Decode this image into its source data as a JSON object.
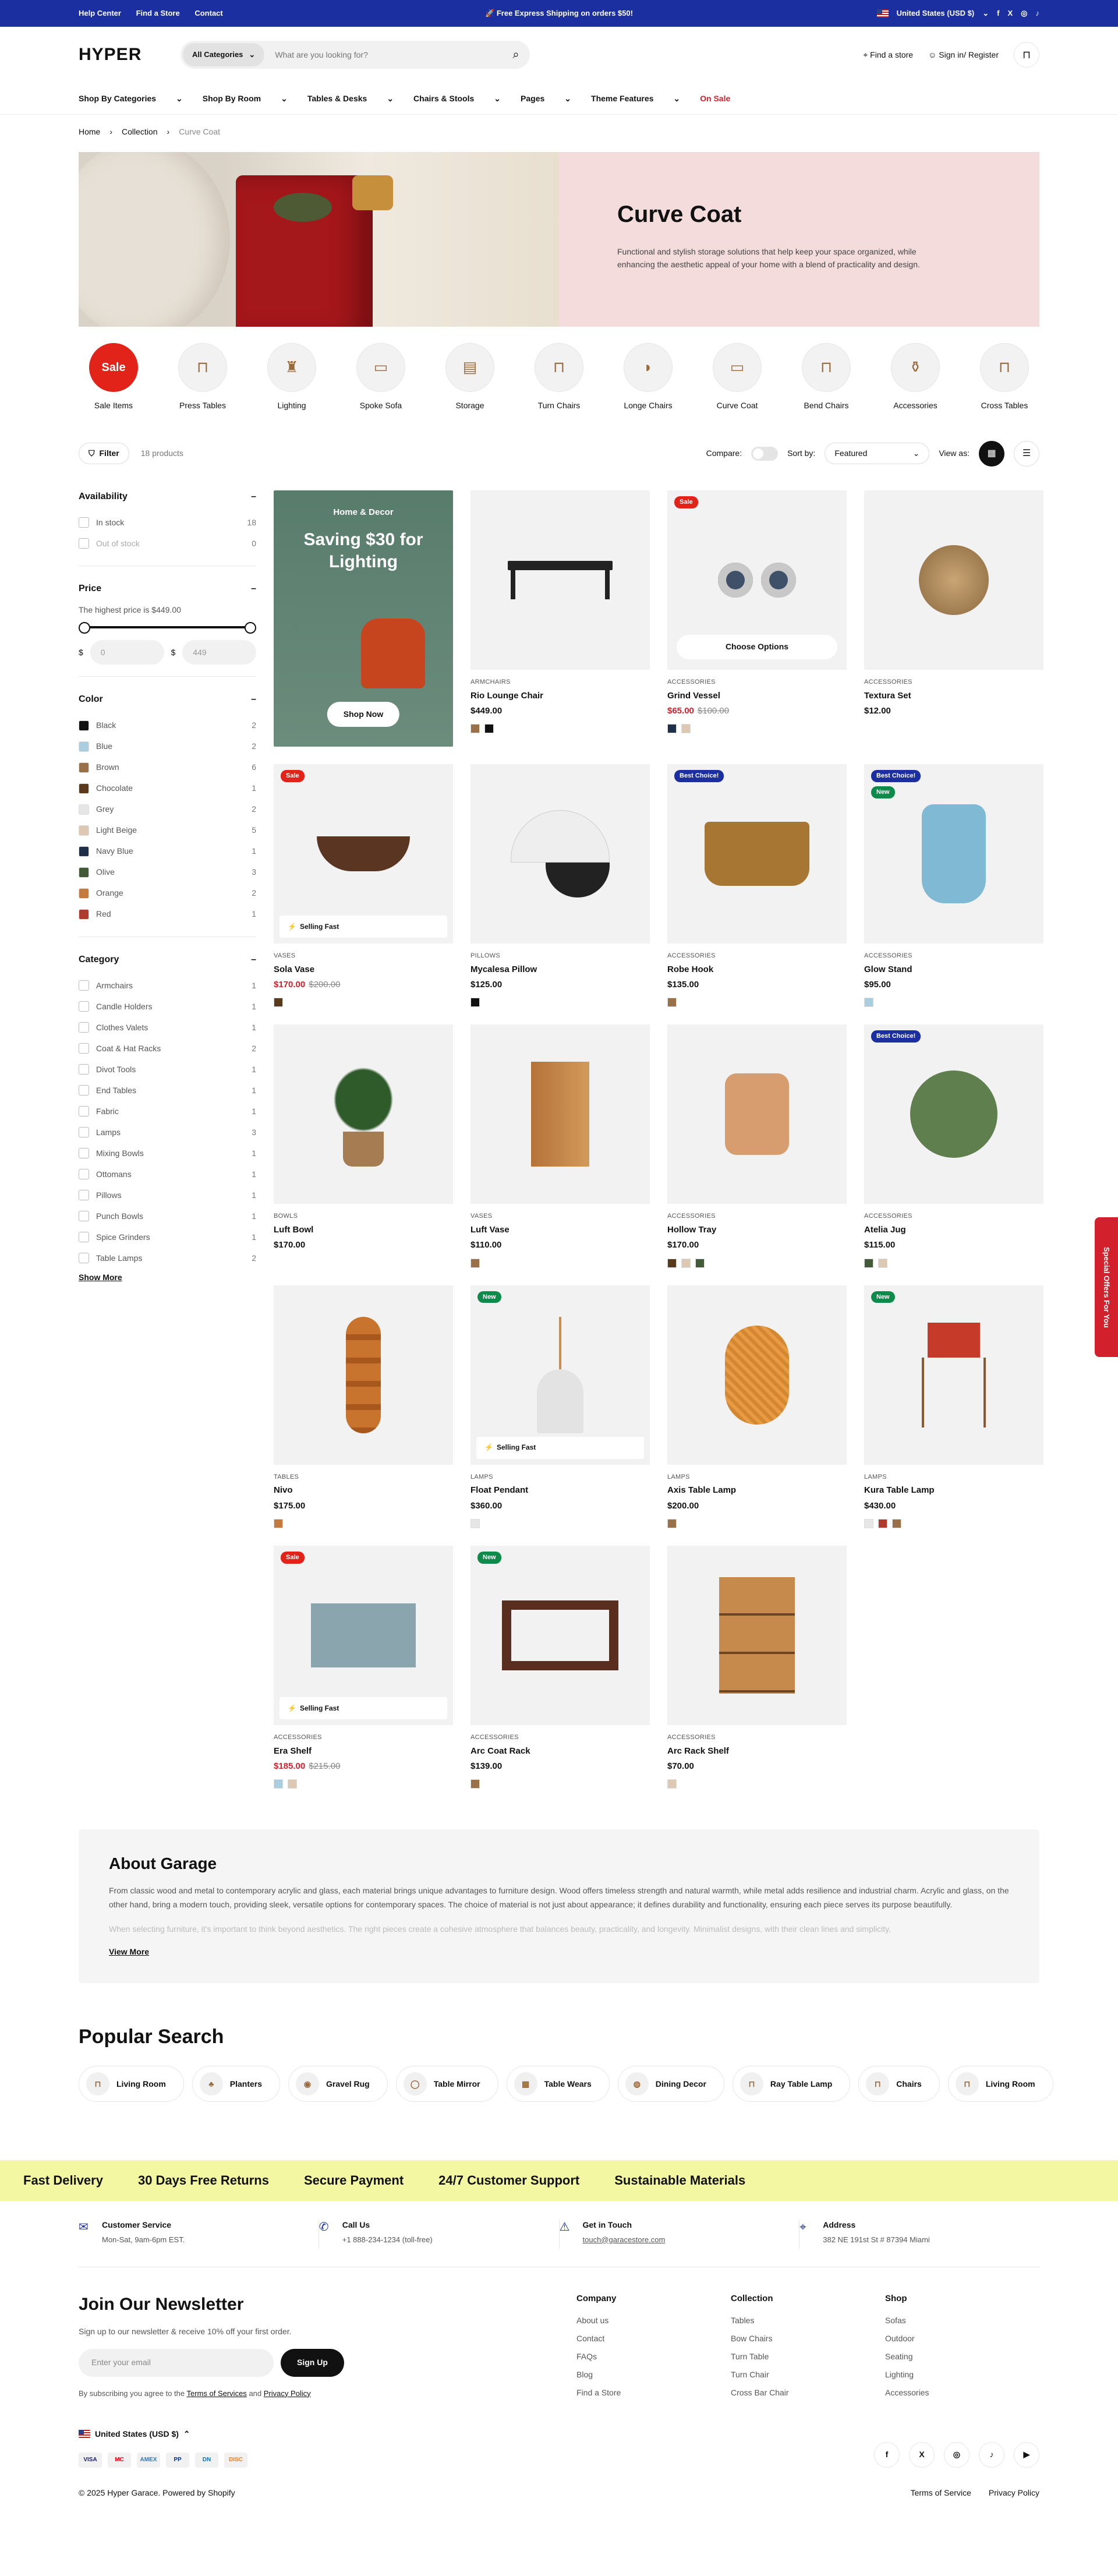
{
  "announcement": {
    "links": [
      "Help Center",
      "Find a Store",
      "Contact"
    ],
    "promo": "🚀 Free Express Shipping on orders $50!",
    "currency": "United States (USD $)"
  },
  "header": {
    "logo": "HYPER",
    "category": "All Categories",
    "search_placeholder": "What are you looking for?",
    "find_store": "Find a store",
    "account": "Sign in/ Register"
  },
  "nav": [
    "Shop By Categories",
    "Shop By Room",
    "Tables & Desks",
    "Chairs & Stools",
    "Pages",
    "Theme Features"
  ],
  "nav_sale": "On Sale",
  "breadcrumb": [
    "Home",
    "Collection",
    "Curve Coat"
  ],
  "hero": {
    "title": "Curve Coat",
    "text": "Functional and stylish storage solutions that help keep your space organized, while enhancing the aesthetic appeal of your home with a blend of practicality and design."
  },
  "categories": [
    "Sale Items",
    "Press Tables",
    "Lighting",
    "Spoke Sofa",
    "Storage",
    "Turn Chairs",
    "Longe Chairs",
    "Curve Coat",
    "Bend Chairs",
    "Accessories",
    "Cross Tables"
  ],
  "sale_badge": "Sale",
  "toolbar": {
    "filter": "Filter",
    "count": "18 products",
    "compare": "Compare:",
    "sort_label": "Sort by:",
    "sort_value": "Featured",
    "view_label": "View as:"
  },
  "filters": {
    "availability": {
      "title": "Availability",
      "items": [
        {
          "label": "In stock",
          "n": "18"
        },
        {
          "label": "Out of stock",
          "n": "0"
        }
      ]
    },
    "price": {
      "title": "Price",
      "text": "The highest price is $449.00",
      "min": "0",
      "max": "449",
      "cur": "$"
    },
    "color": {
      "title": "Color",
      "items": [
        {
          "label": "Black",
          "n": "2",
          "c": "#111111"
        },
        {
          "label": "Blue",
          "n": "2",
          "c": "#aacde0"
        },
        {
          "label": "Brown",
          "n": "6",
          "c": "#9a7048"
        },
        {
          "label": "Chocolate",
          "n": "1",
          "c": "#5a3a1c"
        },
        {
          "label": "Grey",
          "n": "2",
          "c": "#e6e6e6"
        },
        {
          "label": "Light Beige",
          "n": "5",
          "c": "#ddc8b3"
        },
        {
          "label": "Navy Blue",
          "n": "1",
          "c": "#1f2f4a"
        },
        {
          "label": "Olive",
          "n": "3",
          "c": "#435a38"
        },
        {
          "label": "Orange",
          "n": "2",
          "c": "#c47a3c"
        },
        {
          "label": "Red",
          "n": "1",
          "c": "#b03a2e"
        }
      ]
    },
    "category": {
      "title": "Category",
      "items": [
        {
          "label": "Armchairs",
          "n": "1"
        },
        {
          "label": "Candle Holders",
          "n": "1"
        },
        {
          "label": "Clothes Valets",
          "n": "1"
        },
        {
          "label": "Coat & Hat Racks",
          "n": "2"
        },
        {
          "label": "Divot Tools",
          "n": "1"
        },
        {
          "label": "End Tables",
          "n": "1"
        },
        {
          "label": "Fabric",
          "n": "1"
        },
        {
          "label": "Lamps",
          "n": "3"
        },
        {
          "label": "Mixing Bowls",
          "n": "1"
        },
        {
          "label": "Ottomans",
          "n": "1"
        },
        {
          "label": "Pillows",
          "n": "1"
        },
        {
          "label": "Punch Bowls",
          "n": "1"
        },
        {
          "label": "Spice Grinders",
          "n": "1"
        },
        {
          "label": "Table Lamps",
          "n": "2"
        }
      ],
      "more": "Show More"
    }
  },
  "promo": {
    "tag": "Home & Decor",
    "title": "Saving $30 for Lighting",
    "button": "Shop Now"
  },
  "products": [
    {
      "type": "ARMCHAIRS",
      "name": "Rio Lounge Chair",
      "price": "$449.00",
      "swatches": [
        "#9a7048",
        "#111111"
      ],
      "shape": "bench"
    },
    {
      "type": "ACCESSORIES",
      "name": "Grind Vessel",
      "price": "$65.00",
      "old": "$100.00",
      "badge": "Sale",
      "btype": "s",
      "choose": "Choose Options",
      "swatches": [
        "#1f2f4a",
        "#ddc8b3"
      ],
      "shape": "vessel"
    },
    {
      "type": "ACCESSORIES",
      "name": "Textura Set",
      "price": "$12.00",
      "swatches": [],
      "shape": "ball"
    },
    {
      "type": "VASES",
      "name": "Sola Vase",
      "price": "$170.00",
      "old": "$200.00",
      "badge": "Sale",
      "btype": "s",
      "selling": "Selling Fast",
      "swatches": [
        "#5a3a1c"
      ],
      "shape": "bowl"
    },
    {
      "type": "PILLOWS",
      "name": "Mycalesa Pillow",
      "price": "$125.00",
      "swatches": [
        "#111111"
      ],
      "shape": "pillow"
    },
    {
      "type": "ACCESSORIES",
      "name": "Robe Hook",
      "price": "$135.00",
      "badge": "Best Choice!",
      "btype": "b",
      "swatches": [
        "#9a7048"
      ],
      "shape": "basket"
    },
    {
      "type": "ACCESSORIES",
      "name": "Glow Stand",
      "price": "$95.00",
      "badge": "Best Choice!",
      "btype": "b",
      "badge2": "New",
      "swatches": [
        "#aacde0"
      ],
      "shape": "jug"
    },
    {
      "type": "BOWLS",
      "name": "Luft Bowl",
      "price": "$170.00",
      "swatches": [],
      "shape": "plant"
    },
    {
      "type": "VASES",
      "name": "Luft Vase",
      "price": "$110.00",
      "swatches": [
        "#9a7048"
      ],
      "shape": "vase"
    },
    {
      "type": "ACCESSORIES",
      "name": "Hollow Tray",
      "price": "$170.00",
      "swatches": [
        "#5a3a1c",
        "#ddc8b3",
        "#435a38"
      ],
      "shape": "candle"
    },
    {
      "type": "ACCESSORIES",
      "name": "Atelia Jug",
      "price": "$115.00",
      "badge": "Best Choice!",
      "btype": "b",
      "swatches": [
        "#435a38",
        "#ddc8b3"
      ],
      "shape": "disc"
    },
    {
      "type": "TABLES",
      "name": "Nivo",
      "price": "$175.00",
      "swatches": [
        "#c47a3c"
      ],
      "shape": "holder"
    },
    {
      "type": "LAMPS",
      "name": "Float Pendant",
      "price": "$360.00",
      "badge": "New",
      "btype": "n",
      "selling": "Selling Fast",
      "swatches": [
        "#e6e6e6"
      ],
      "shape": "pendant"
    },
    {
      "type": "LAMPS",
      "name": "Axis Table Lamp",
      "price": "$200.00",
      "swatches": [
        "#9a7048"
      ],
      "shape": "lamp"
    },
    {
      "type": "LAMPS",
      "name": "Kura Table Lamp",
      "price": "$430.00",
      "badge": "New",
      "btype": "n",
      "swatches": [
        "#e6e6e6",
        "#b03a2e",
        "#9a7048"
      ],
      "shape": "tripod"
    },
    {
      "type": "ACCESSORIES",
      "name": "Era Shelf",
      "price": "$185.00",
      "old": "$215.00",
      "badge": "Sale",
      "btype": "s",
      "selling": "Selling Fast",
      "swatches": [
        "#aacde0",
        "#ddc8b3"
      ],
      "shape": "cabinet"
    },
    {
      "type": "ACCESSORIES",
      "name": "Arc Coat Rack",
      "price": "$139.00",
      "badge": "New",
      "btype": "n",
      "swatches": [
        "#9a7048"
      ],
      "shape": "frame"
    },
    {
      "type": "ACCESSORIES",
      "name": "Arc Rack Shelf",
      "price": "$70.00",
      "swatches": [
        "#ddc8b3"
      ],
      "shape": "drawers"
    }
  ],
  "about": {
    "title": "About Garage",
    "p1": "From classic wood and metal to contemporary acrylic and glass, each material brings unique advantages to furniture design. Wood offers timeless strength and natural warmth, while metal adds resilience and industrial charm. Acrylic and glass, on the other hand, bring a modern touch, providing sleek, versatile options for contemporary spaces. The choice of material is not just about appearance; it defines durability and functionality, ensuring each piece serves its purpose beautifully.",
    "p2": "When selecting furniture, it's important to think beyond aesthetics. The right pieces create a cohesive atmosphere that balances beauty, practicality, and longevity. Minimalist designs, with their clean lines and simplicity,",
    "more": "View More"
  },
  "popular": {
    "title": "Popular Search",
    "items": [
      "Living Room",
      "Planters",
      "Gravel Rug",
      "Table Mirror",
      "Table Wears",
      "Dining Decor",
      "Ray Table Lamp",
      "Chairs",
      "Living Room"
    ]
  },
  "marquee": [
    "Fast Delivery",
    "30 Days Free Returns",
    "Secure Payment",
    "24/7 Customer Support",
    "Sustainable Materials"
  ],
  "contact": [
    {
      "title": "Customer Service",
      "text": "Mon-Sat, 9am-6pm EST."
    },
    {
      "title": "Call Us",
      "text": "+1 888-234-1234 (toll-free)"
    },
    {
      "title": "Get in Touch",
      "text": "touch@garacestore.com"
    },
    {
      "title": "Address",
      "text": "382 NE 191st St # 87394 Miami"
    }
  ],
  "newsletter": {
    "title": "Join Our Newsletter",
    "text": "Sign up to our newsletter & receive 10% off your first order.",
    "placeholder": "Enter your email",
    "button": "Sign Up",
    "terms_pre": "By subscribing you agree to the",
    "terms": "Terms of Services",
    "and": "and",
    "privacy": "Privacy Policy",
    "currency": "United States (USD $)"
  },
  "footer_cols": [
    {
      "title": "Company",
      "links": [
        "About us",
        "Contact",
        "FAQs",
        "Blog",
        "Find a Store"
      ]
    },
    {
      "title": "Collection",
      "links": [
        "Tables",
        "Bow Chairs",
        "Turn Table",
        "Turn Chair",
        "Cross Bar Chair"
      ]
    },
    {
      "title": "Shop",
      "links": [
        "Sofas",
        "Outdoor",
        "Seating",
        "Lighting",
        "Accessories"
      ]
    }
  ],
  "payments": [
    "VISA",
    "MC",
    "AMEX",
    "PP",
    "DN",
    "DISC"
  ],
  "social": [
    "f",
    "X",
    "◎",
    "♪",
    "▶"
  ],
  "copyright": "© 2025 Hyper Garace. Powered by Shopify",
  "legal": [
    "Terms of Service",
    "Privacy Policy"
  ],
  "offer_tab": "Special Offers For You"
}
